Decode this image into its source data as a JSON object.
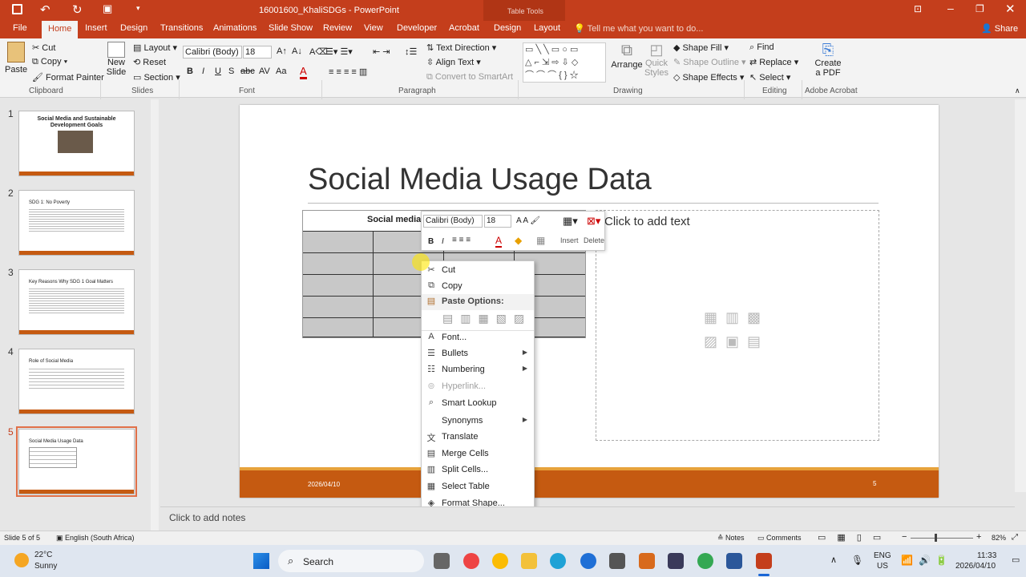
{
  "app": {
    "title": "16001600_KhaliSDGs - PowerPoint",
    "context_tab": "Table Tools",
    "tell_me": "Tell me what you want to do...",
    "share": "Share"
  },
  "tabs": [
    "File",
    "Home",
    "Insert",
    "Design",
    "Transitions",
    "Animations",
    "Slide Show",
    "Review",
    "View",
    "Developer",
    "Acrobat",
    "Design",
    "Layout"
  ],
  "ribbon": {
    "clipboard": {
      "paste": "Paste",
      "cut": "Cut",
      "copy": "Copy",
      "format_painter": "Format Painter",
      "label": "Clipboard"
    },
    "slides": {
      "new_slide": "New",
      "new_slide2": "Slide",
      "layout": "Layout",
      "reset": "Reset",
      "section": "Section",
      "label": "Slides"
    },
    "font": {
      "name": "Calibri (Body)",
      "size": "18",
      "label": "Font"
    },
    "paragraph": {
      "text_direction": "Text Direction",
      "align_text": "Align Text",
      "convert": "Convert to SmartArt",
      "label": "Paragraph"
    },
    "drawing": {
      "arrange": "Arrange",
      "quick_styles": "Quick",
      "quick_styles2": "Styles",
      "shape_fill": "Shape Fill",
      "shape_outline": "Shape Outline",
      "shape_effects": "Shape Effects",
      "label": "Drawing"
    },
    "editing": {
      "find": "Find",
      "replace": "Replace",
      "select": "Select",
      "label": "Editing"
    },
    "acrobat": {
      "create": "Create",
      "create2": "a PDF",
      "label": "Adobe Acrobat"
    }
  },
  "thumbnails": [
    {
      "num": "1",
      "title": "Social Media and Sustainable Development Goals"
    },
    {
      "num": "2",
      "title": "SDG 1: No Poverty"
    },
    {
      "num": "3",
      "title": "Key Reasons Why SDG 1 Goal Matters"
    },
    {
      "num": "4",
      "title": "Role of Social Media"
    },
    {
      "num": "5",
      "title": "Social Media Usage Data"
    }
  ],
  "slide": {
    "title": "Social Media Usage Data",
    "table_header": "Social media",
    "placeholder": "Click to add text",
    "date": "2026/04/10",
    "number": "5"
  },
  "mini_toolbar": {
    "font": "Calibri (Body)",
    "size": "18",
    "insert": "Insert",
    "delete": "Delete"
  },
  "context_menu": [
    {
      "label": "Cut",
      "icon": "cut-icon"
    },
    {
      "label": "Copy",
      "icon": "copy-icon"
    },
    {
      "label": "Paste Options:",
      "icon": "paste-icon"
    },
    {
      "label": "Font...",
      "icon": "font-icon"
    },
    {
      "label": "Bullets",
      "icon": "bullets-icon"
    },
    {
      "label": "Numbering",
      "icon": "numbering-icon"
    },
    {
      "label": "Hyperlink...",
      "icon": "hyperlink-icon"
    },
    {
      "label": "Smart Lookup",
      "icon": "search-icon"
    },
    {
      "label": "Synonyms",
      "icon": ""
    },
    {
      "label": "Translate",
      "icon": "translate-icon"
    },
    {
      "label": "Merge Cells",
      "icon": "merge-cells-icon"
    },
    {
      "label": "Split Cells...",
      "icon": "split-cells-icon"
    },
    {
      "label": "Select Table",
      "icon": "select-table-icon"
    },
    {
      "label": "Format Shape...",
      "icon": "format-shape-icon"
    }
  ],
  "notes_placeholder": "Click to add notes",
  "status": {
    "slide": "Slide 5 of 5",
    "language": "English (South Africa)",
    "notes": "Notes",
    "comments": "Comments",
    "zoom": "82%"
  },
  "taskbar": {
    "temp": "22°C",
    "weather": "Sunny",
    "search": "Search",
    "lang1": "ENG",
    "lang2": "US",
    "time": "11:33",
    "date": "2026/04/10"
  }
}
